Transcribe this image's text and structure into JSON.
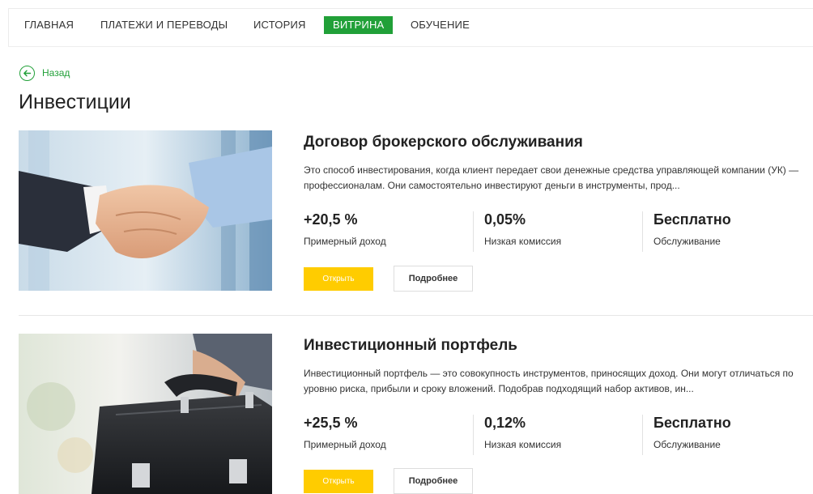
{
  "nav": {
    "items": [
      {
        "label": "ГЛАВНАЯ"
      },
      {
        "label": "ПЛАТЕЖИ И ПЕРЕВОДЫ"
      },
      {
        "label": "ИСТОРИЯ"
      },
      {
        "label": "ВИТРИНА",
        "active": true
      },
      {
        "label": "ОБУЧЕНИЕ"
      }
    ]
  },
  "back": {
    "label": "Назад",
    "icon": "arrow-left-circle-icon"
  },
  "page": {
    "title": "Инвестиции"
  },
  "products": [
    {
      "title": "Договор брокерского обслуживания",
      "description": "Это способ инвестирования, когда клиент передает свои денежные средства управляющей компании (УК) — профессионалам. Они самостоятельно инвестируют деньги в инструменты, прод...",
      "image": "handshake-photo",
      "stats": [
        {
          "value": "+20,5 %",
          "label": "Примерный доход"
        },
        {
          "value": "0,05%",
          "label": "Низкая комиссия"
        },
        {
          "value": "Бесплатно",
          "label": "Обслуживание"
        }
      ],
      "open_label": "Открыть",
      "more_label": "Подробнее"
    },
    {
      "title": "Инвестиционный портфель",
      "description": "Инвестиционный портфель — это совокупность инструментов, приносящих доход. Они могут отличаться по уровню риска, прибыли и сроку вложений. Подобрав подходящий набор активов, ин...",
      "image": "briefcase-photo",
      "stats": [
        {
          "value": "+25,5 %",
          "label": "Примерный доход"
        },
        {
          "value": "0,12%",
          "label": "Низкая комиссия"
        },
        {
          "value": "Бесплатно",
          "label": "Обслуживание"
        }
      ],
      "open_label": "Открыть",
      "more_label": "Подробнее"
    }
  ],
  "colors": {
    "accent": "#21a038",
    "button_primary": "#ffcc00"
  }
}
